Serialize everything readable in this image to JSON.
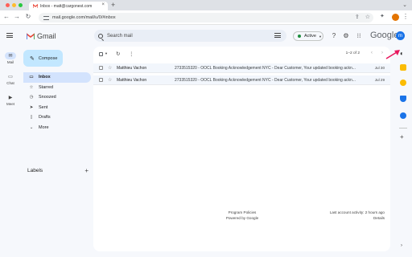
{
  "browser": {
    "tab_title": "Inbox - matt@cargonest.com",
    "url": "mail.google.com/mail/u/0/#inbox"
  },
  "gmail": {
    "brand_name": "Gmail",
    "search_placeholder": "Search mail",
    "status_label": "Active",
    "google_wordmark": "Google",
    "avatar_letter": "m",
    "compose_label": "Compose",
    "rail": [
      {
        "label": "Mail",
        "icon": "mail-icon"
      },
      {
        "label": "Chat",
        "icon": "chat-icon"
      },
      {
        "label": "Meet",
        "icon": "meet-icon"
      }
    ],
    "folders": [
      {
        "label": "Inbox",
        "icon": "inbox-icon",
        "active": true
      },
      {
        "label": "Starred",
        "icon": "star-icon"
      },
      {
        "label": "Snoozed",
        "icon": "clock-icon"
      },
      {
        "label": "Sent",
        "icon": "send-icon"
      },
      {
        "label": "Drafts",
        "icon": "draft-icon"
      },
      {
        "label": "More",
        "icon": "chevron-down-icon"
      }
    ],
    "labels_title": "Labels",
    "pagination": "1–2 of 2",
    "emails": [
      {
        "sender": "Matthieu Vachon",
        "subject": "2733515320 - OOCL Booking Acknowledgement NYC - Dear Customer, Your updated booking ackn...",
        "date": "Jul 30"
      },
      {
        "sender": "Matthieu Vachon",
        "subject": "2733515320 - OOCL Booking Acknowledgement NYC - Dear Customer, Your updated booking ackn...",
        "date": "Jul 29"
      }
    ],
    "footer": {
      "program_policies": "Program Policies",
      "powered_by": "Powered by Google",
      "last_activity": "Last account activity: 2 hours ago",
      "details": "Details"
    }
  },
  "colors": {
    "accent": "#c2e7ff",
    "active_folder": "#d3e3fd",
    "status_green": "#1e8e3e",
    "annotation_arrow": "#e8175d"
  }
}
